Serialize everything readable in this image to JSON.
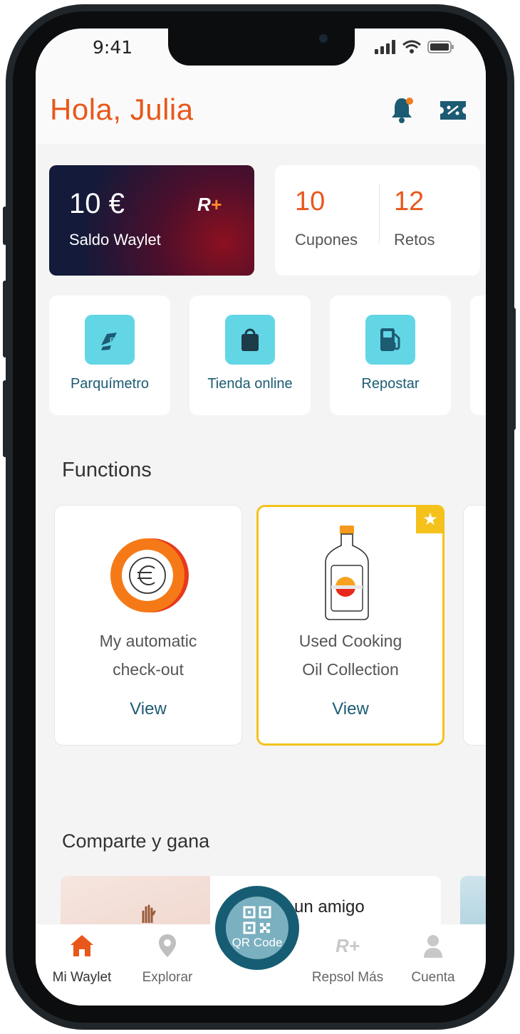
{
  "status": {
    "time": "9:41"
  },
  "header": {
    "greeting": "Hola, Julia"
  },
  "balance": {
    "amount": "10 €",
    "label": "Saldo Waylet",
    "brand": "R+"
  },
  "counts": [
    {
      "value": "10",
      "label": "Cupones"
    },
    {
      "value": "12",
      "label": "Retos"
    }
  ],
  "quick_actions": [
    {
      "label": "Parquímetro",
      "icon": "parking-icon"
    },
    {
      "label": "Tienda online",
      "icon": "shopping-bag-icon"
    },
    {
      "label": "Repostar",
      "icon": "fuel-icon"
    }
  ],
  "functions": {
    "title": "Functions",
    "cards": [
      {
        "title_line1": "My automatic",
        "title_line2": "check-out",
        "action": "View",
        "icon": "euro-coin-icon"
      },
      {
        "title_line1": "Used Cooking",
        "title_line2": "Oil Collection",
        "action": "View",
        "icon": "oil-bottle-icon",
        "featured": true
      }
    ]
  },
  "share": {
    "title": "Comparte y gana",
    "card_text": "un amigo"
  },
  "nav": {
    "items": [
      {
        "label": "Mi Waylet",
        "icon": "home-icon"
      },
      {
        "label": "Explorar",
        "icon": "map-pin-icon"
      },
      {
        "label": "Repsol Más",
        "icon": "rplus-icon"
      },
      {
        "label": "Cuenta",
        "icon": "user-icon"
      }
    ],
    "qr_label": "QR Code"
  },
  "colors": {
    "accent": "#e8581c",
    "teal": "#1d5b73",
    "cyan": "#63d6e6",
    "gold": "#f4c21b"
  }
}
